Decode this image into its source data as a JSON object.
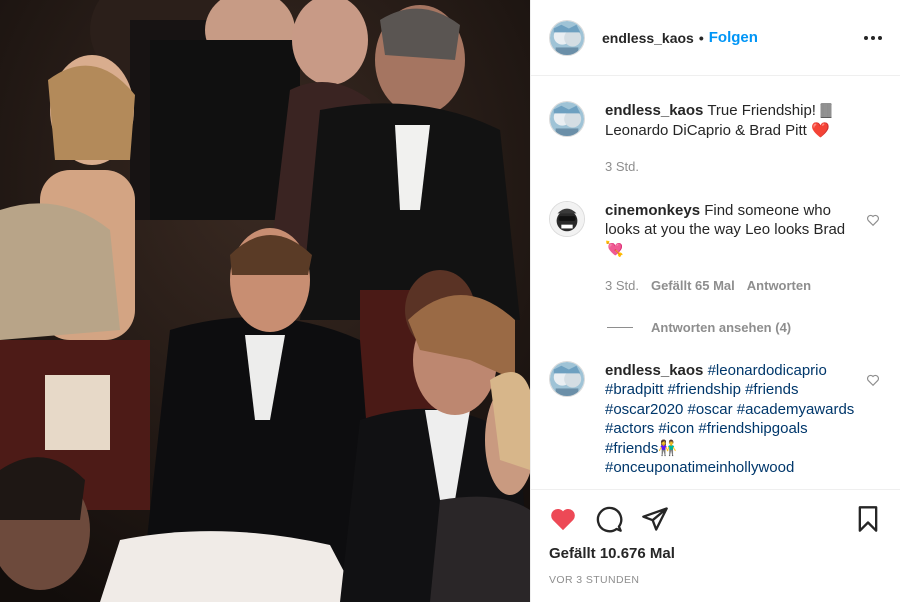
{
  "post": {
    "username": "endless_kaos",
    "follow_label": "Folgen",
    "dot": "•"
  },
  "comments": [
    {
      "username": "endless_kaos",
      "text": "True Friendship! 🀫 Leonardo DiCaprio & Brad Pitt ❤️",
      "time": "3 Std."
    },
    {
      "username": "cinemonkeys",
      "text": "Find someone who looks at you the way Leo looks Brad 💘",
      "time": "3 Std.",
      "likes": "Gefällt 65 Mal",
      "reply": "Antworten",
      "view_replies": "Antworten ansehen (4)"
    },
    {
      "username": "endless_kaos",
      "text": "#leonardodicaprio #bradpitt #friendship #friends #oscar2020 #oscar #academyawards #actors #icon #friendshipgoals #friends👫 #onceuponatimeinhollywood"
    }
  ],
  "footer": {
    "likes": "Gefällt 10.676 Mal",
    "timestamp": "VOR 3 STUNDEN"
  },
  "colors": {
    "accent": "#0095f6",
    "like_red": "#ed4956",
    "muted": "#8e8e8e"
  },
  "icons": [
    "heart-icon",
    "comment-icon",
    "share-icon",
    "bookmark-icon",
    "more-icon"
  ]
}
